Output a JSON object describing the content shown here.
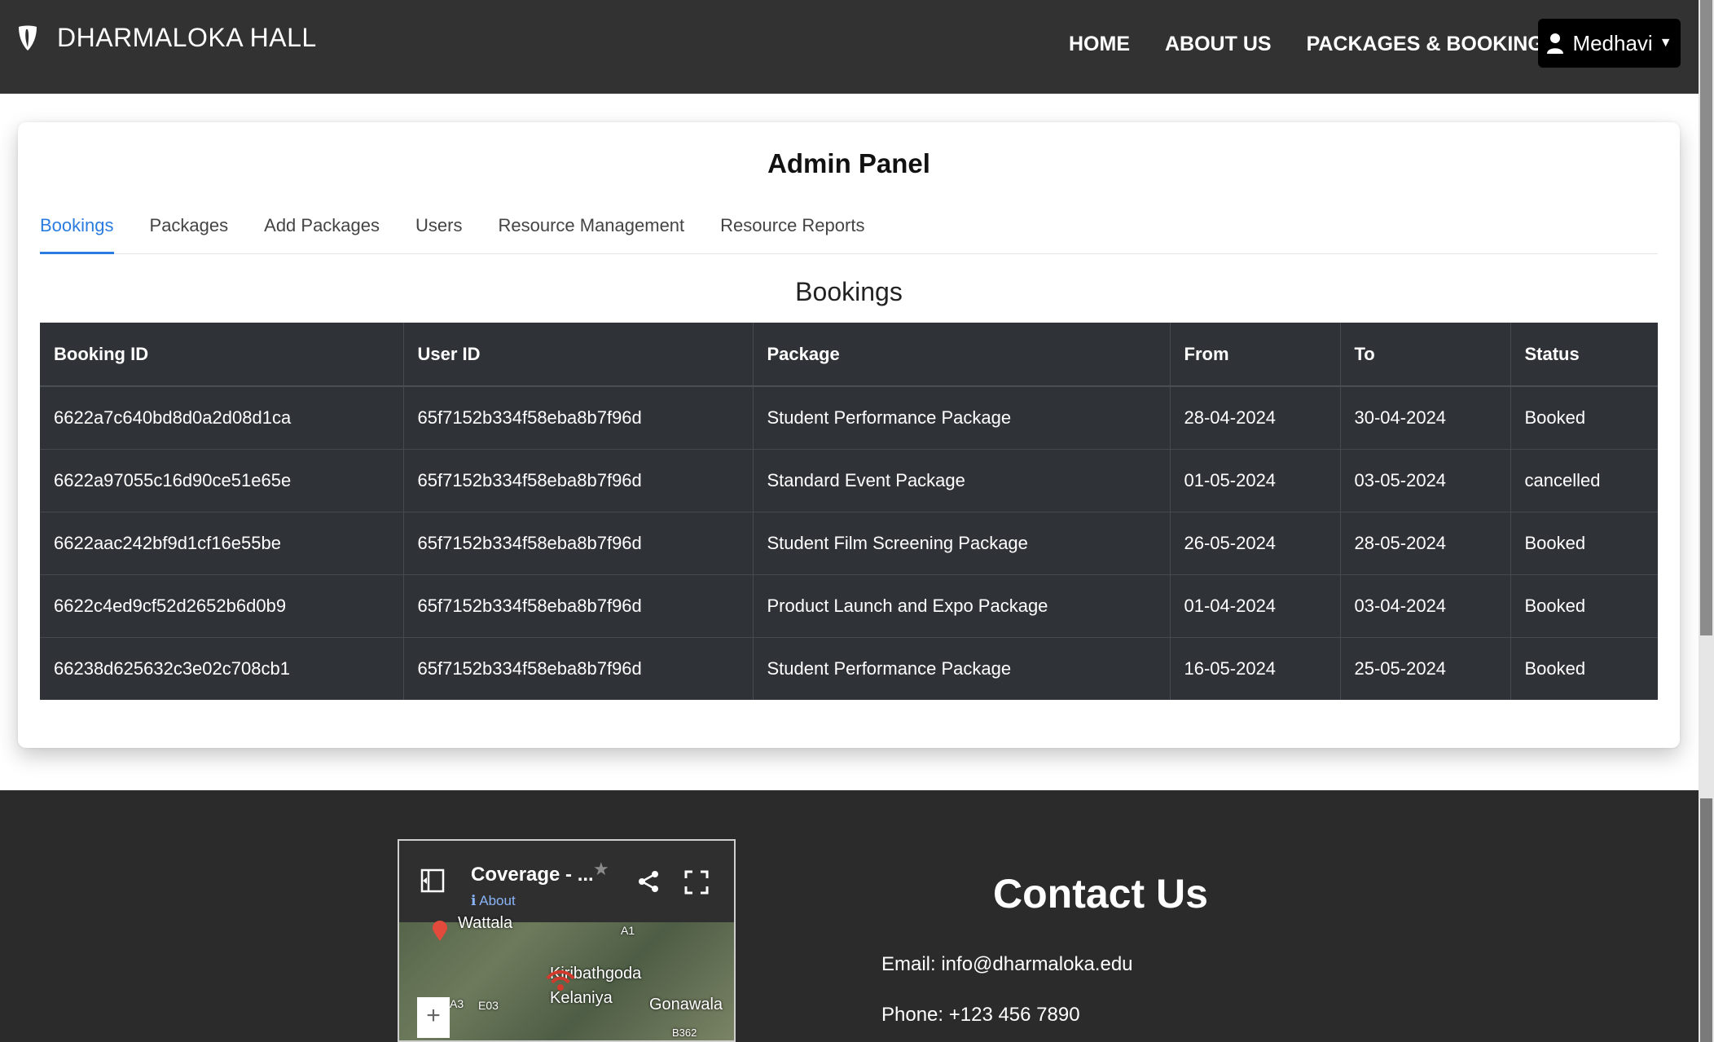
{
  "navbar": {
    "brand": "DHARMALOKA HALL",
    "links": [
      "HOME",
      "ABOUT US",
      "PACKAGES & BOOKING"
    ],
    "user": "Medhavi"
  },
  "admin": {
    "title": "Admin Panel",
    "tabs": [
      "Bookings",
      "Packages",
      "Add Packages",
      "Users",
      "Resource Management",
      "Resource Reports"
    ],
    "active_tab": "Bookings",
    "section_title": "Bookings",
    "table": {
      "headers": [
        "Booking ID",
        "User ID",
        "Package",
        "From",
        "To",
        "Status"
      ],
      "rows": [
        [
          "6622a7c640bd8d0a2d08d1ca",
          "65f7152b334f58eba8b7f96d",
          "Student Performance Package",
          "28-04-2024",
          "30-04-2024",
          "Booked"
        ],
        [
          "6622a97055c16d90ce51e65e",
          "65f7152b334f58eba8b7f96d",
          "Standard Event Package",
          "01-05-2024",
          "03-05-2024",
          "cancelled"
        ],
        [
          "6622aac242bf9d1cf16e55be",
          "65f7152b334f58eba8b7f96d",
          "Student Film Screening Package",
          "26-05-2024",
          "28-05-2024",
          "Booked"
        ],
        [
          "6622c4ed9cf52d2652b6d0b9",
          "65f7152b334f58eba8b7f96d",
          "Product Launch and Expo Package",
          "01-04-2024",
          "03-04-2024",
          "Booked"
        ],
        [
          "66238d625632c3e02c708cb1",
          "65f7152b334f58eba8b7f96d",
          "Student Performance Package",
          "16-05-2024",
          "25-05-2024",
          "Booked"
        ]
      ]
    }
  },
  "map": {
    "title": "Coverage - ...",
    "about": "About",
    "labels": [
      "Wattala",
      "Kiribathgoda",
      "Kelaniya",
      "Gonawala",
      "A1",
      "A3",
      "E03",
      "B362"
    ],
    "zoom": "+"
  },
  "contact": {
    "title": "Contact Us",
    "email": "Email: info@dharmaloka.edu",
    "phone": "Phone: +123 456 7890"
  },
  "colors": {
    "navbar": "#323232",
    "accent": "#2a7ce0",
    "table_bg": "#2f3338",
    "footer": "#2b2b2b"
  }
}
